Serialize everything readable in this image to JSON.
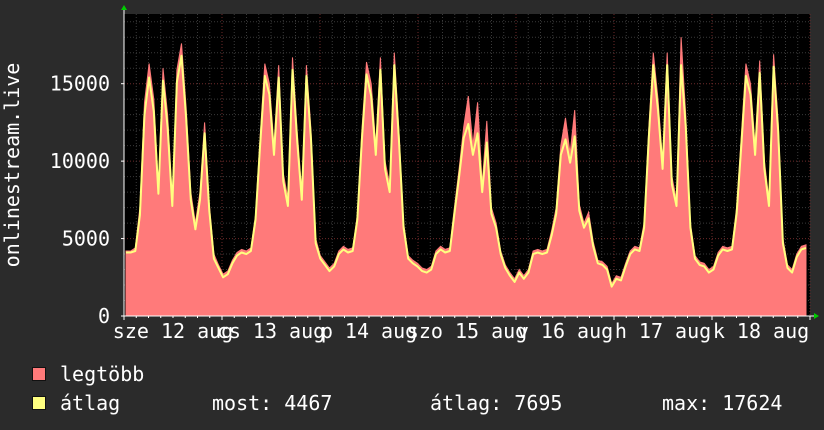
{
  "chart_data": {
    "type": "area",
    "ylabel": "onlinestream.live",
    "ylim": [
      0,
      19500
    ],
    "yticks": [
      0,
      5000,
      10000,
      15000
    ],
    "grid": true,
    "xticks": [
      "sze 12 aug",
      "cs 13 aug",
      "p 14 aug",
      "szo 15 aug",
      "v 16 aug",
      "h 17 aug",
      "k 18 aug"
    ],
    "days": 7,
    "series": [
      {
        "name": "legtöbb",
        "style": "area",
        "color": "#ff7a7a",
        "values": [
          4200,
          4200,
          4400,
          7000,
          13800,
          16300,
          14000,
          8400,
          16000,
          13000,
          7600,
          15900,
          17600,
          13500,
          8000,
          6000,
          8000,
          12500,
          7200,
          4000,
          3300,
          2700,
          2900,
          3600,
          4100,
          4300,
          4200,
          4400,
          6500,
          11500,
          16300,
          15000,
          11000,
          16200,
          9200,
          7600,
          16700,
          11900,
          8000,
          16200,
          12000,
          5000,
          3900,
          3500,
          3100,
          3400,
          4200,
          4500,
          4300,
          4400,
          6500,
          12000,
          16400,
          15000,
          11000,
          16700,
          10000,
          8500,
          17000,
          12000,
          6000,
          3900,
          3600,
          3400,
          3100,
          3000,
          3200,
          4200,
          4500,
          4300,
          4400,
          7000,
          9500,
          12200,
          14200,
          11000,
          13800,
          8500,
          12600,
          7000,
          6000,
          4200,
          3300,
          2800,
          2400,
          3000,
          2600,
          3000,
          4200,
          4300,
          4200,
          4300,
          5500,
          7000,
          11000,
          12800,
          10500,
          13300,
          7200,
          6000,
          6700,
          4800,
          3600,
          3500,
          3200,
          2100,
          2600,
          2500,
          3400,
          4200,
          4500,
          4400,
          6000,
          12000,
          17000,
          14000,
          10000,
          17000,
          9000,
          7500,
          18000,
          13000,
          6000,
          3900,
          3500,
          3400,
          3000,
          3200,
          4100,
          4500,
          4400,
          4500,
          7000,
          11500,
          16300,
          15000,
          11000,
          16500,
          10000,
          7500,
          16900,
          12500,
          5000,
          3300,
          3000,
          4000,
          4500,
          4600
        ]
      },
      {
        "name": "átlag",
        "style": "line",
        "color": "#ffff80",
        "values": [
          4100,
          4100,
          4200,
          6500,
          13000,
          15400,
          13200,
          7900,
          15200,
          12200,
          7100,
          15100,
          16800,
          12800,
          7500,
          5600,
          7500,
          11800,
          6800,
          3700,
          3100,
          2500,
          2700,
          3400,
          3900,
          4100,
          4000,
          4200,
          6200,
          11000,
          15500,
          14300,
          10400,
          15400,
          8700,
          7100,
          15900,
          11300,
          7500,
          15500,
          11400,
          4700,
          3700,
          3300,
          2900,
          3200,
          4000,
          4300,
          4100,
          4200,
          6200,
          11400,
          15600,
          14200,
          10400,
          15900,
          9500,
          8000,
          16200,
          11400,
          5700,
          3700,
          3400,
          3200,
          2900,
          2800,
          3000,
          4000,
          4300,
          4100,
          4200,
          6600,
          9000,
          11500,
          12400,
          10400,
          11800,
          8000,
          11200,
          6600,
          5700,
          4000,
          3100,
          2600,
          2200,
          2800,
          2400,
          2800,
          4000,
          4100,
          4000,
          4100,
          5200,
          6600,
          10400,
          11400,
          9900,
          11600,
          6800,
          5700,
          6300,
          4500,
          3400,
          3300,
          3000,
          1900,
          2400,
          2300,
          3200,
          4000,
          4300,
          4200,
          5700,
          11400,
          16200,
          13300,
          9500,
          16200,
          8500,
          7100,
          16200,
          12300,
          5700,
          3700,
          3300,
          3200,
          2800,
          3000,
          3900,
          4300,
          4200,
          4300,
          6600,
          10900,
          15500,
          14300,
          10400,
          15700,
          9500,
          7100,
          16100,
          11900,
          4700,
          3100,
          2800,
          3800,
          4300,
          4400
        ]
      }
    ]
  },
  "legend": {
    "items": [
      {
        "label": "legtöbb",
        "color": "#ff7a7a"
      },
      {
        "label": "átlag",
        "color": "#ffff80"
      }
    ],
    "stats": {
      "now": "most: 4467",
      "avg": "átlag: 7695",
      "max": "max: 17624"
    }
  }
}
